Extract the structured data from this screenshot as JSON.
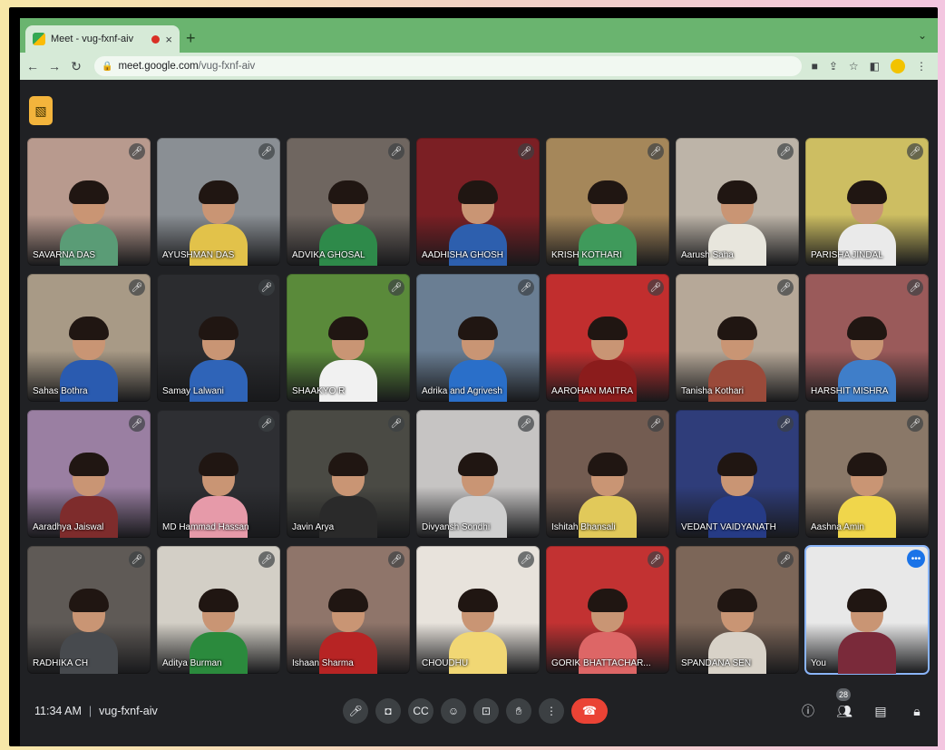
{
  "browser": {
    "tab_title": "Meet - vug-fxnf-aiv",
    "tab_close": "×",
    "new_tab": "+",
    "url_domain": "meet.google.com",
    "url_path": "/vug-fxnf-aiv"
  },
  "meeting": {
    "time": "11:34 AM",
    "separator": "|",
    "code": "vug-fxnf-aiv",
    "participant_count": "28"
  },
  "participants": [
    {
      "name": "SAVARNA DAS",
      "bg": "#b89a8e",
      "shirt": "#5a9c76"
    },
    {
      "name": "AYUSHMAN DAS",
      "bg": "#8a8f94",
      "shirt": "#e2c24a"
    },
    {
      "name": "ADVIKA GHOSAL",
      "bg": "#6f6660",
      "shirt": "#2e8a4a"
    },
    {
      "name": "AADHISHA GHOSH",
      "bg": "#7b1f24",
      "shirt": "#2d5fae"
    },
    {
      "name": "KRISH KOTHARI",
      "bg": "#a5875a",
      "shirt": "#3f9a5b"
    },
    {
      "name": "Aarush Saha",
      "bg": "#bdb4a8",
      "shirt": "#e8e6dd"
    },
    {
      "name": "PARISHA JINDAL",
      "bg": "#cdbe62",
      "shirt": "#eaeaea"
    },
    {
      "name": "Sahas Bothra",
      "bg": "#a89a86",
      "shirt": "#2a5bb0"
    },
    {
      "name": "Samay Lalwani",
      "bg": "#2b2c2f",
      "shirt": "#2f64b8"
    },
    {
      "name": "SHAAKYO R",
      "bg": "#5a8a3a",
      "shirt": "#f1f1f1"
    },
    {
      "name": "Adrika and Agrivesh",
      "bg": "#6a7e93",
      "shirt": "#2a6fc9"
    },
    {
      "name": "AAROHAN MAITRA",
      "bg": "#c12e2e",
      "shirt": "#8b1c1c"
    },
    {
      "name": "Tanisha Kothari",
      "bg": "#b6a898",
      "shirt": "#9a4a3a"
    },
    {
      "name": "HARSHIT MISHRA",
      "bg": "#9a5a5a",
      "shirt": "#3f7ec9"
    },
    {
      "name": "Aaradhya Jaiswal",
      "bg": "#9a7fa2",
      "shirt": "#7e2c2c"
    },
    {
      "name": "MD Hammad Hassan",
      "bg": "#2e2f33",
      "shirt": "#e69aa9"
    },
    {
      "name": "Javin Arya",
      "bg": "#4a4a44",
      "shirt": "#2a2a2a"
    },
    {
      "name": "Divyansh Sondhi",
      "bg": "#c6c4c3",
      "shirt": "#cfcfcf"
    },
    {
      "name": "Ishitah Bhansali",
      "bg": "#735c51",
      "shirt": "#e1c95a"
    },
    {
      "name": "VEDANT VAIDYANATH",
      "bg": "#2f3d7a",
      "shirt": "#263b86"
    },
    {
      "name": "Aashna Amin",
      "bg": "#8a7868",
      "shirt": "#f0d64b"
    },
    {
      "name": "RADHIKA CH",
      "bg": "#5f5a56",
      "shirt": "#474a4e"
    },
    {
      "name": "Aditya Burman",
      "bg": "#d3cfc6",
      "shirt": "#2b8a3d"
    },
    {
      "name": "Ishaan Sharma",
      "bg": "#8f756a",
      "shirt": "#b72424"
    },
    {
      "name": "CHOUDHU",
      "bg": "#e8e3dc",
      "shirt": "#f1d774"
    },
    {
      "name": "GORIK BHATTACHAR...",
      "bg": "#c23232",
      "shirt": "#d66"
    },
    {
      "name": "SPANDANA SEN",
      "bg": "#7c6658",
      "shirt": "#d8d2c8"
    },
    {
      "name": "You",
      "bg": "#e8e8e8",
      "shirt": "#7a2a3a",
      "self": true
    }
  ]
}
